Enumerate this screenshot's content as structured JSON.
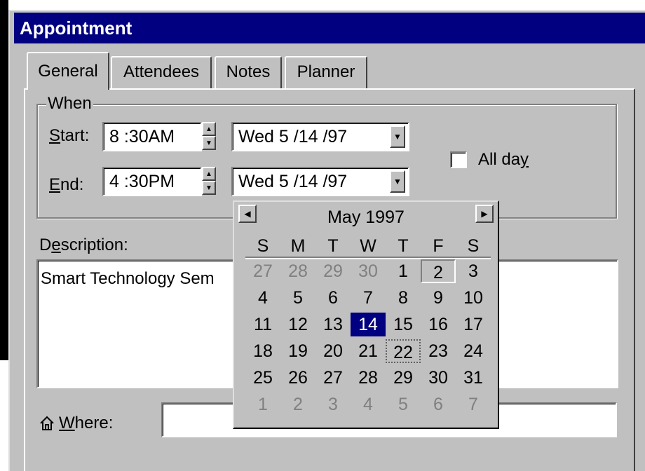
{
  "window": {
    "title": "Appointment"
  },
  "tabs": [
    {
      "label": "General",
      "active": true
    },
    {
      "label": "Attendees"
    },
    {
      "label": "Notes"
    },
    {
      "label": "Planner"
    }
  ],
  "when": {
    "group_label": "When",
    "start": {
      "label_u": "S",
      "label_rest": "tart:",
      "time": "8 :30AM",
      "date": "Wed  5  /14 /97"
    },
    "end": {
      "label_u": "E",
      "label_rest": "nd:",
      "time": "4 :30PM",
      "date": "Wed  5  /14 /97"
    },
    "all_day": {
      "label_pre": "All da",
      "label_u": "y",
      "checked": false
    }
  },
  "description": {
    "label_pre": "D",
    "label_u": "e",
    "label_rest": "scription:",
    "value": "Smart Technology Sem"
  },
  "where": {
    "label_u": "W",
    "label_rest": "here:",
    "value": "",
    "icon": "house-icon"
  },
  "calendar": {
    "month_label": "May 1997",
    "prev_icon": "left-arrow-icon",
    "next_icon": "right-arrow-icon",
    "weekdays": [
      "S",
      "M",
      "T",
      "W",
      "T",
      "F",
      "S"
    ],
    "weeks": [
      [
        "27",
        "28",
        "29",
        "30",
        "1",
        "2",
        "3"
      ],
      [
        "4",
        "5",
        "6",
        "7",
        "8",
        "9",
        "10"
      ],
      [
        "11",
        "12",
        "13",
        "14",
        "15",
        "16",
        "17"
      ],
      [
        "18",
        "19",
        "20",
        "21",
        "22",
        "23",
        "24"
      ],
      [
        "25",
        "26",
        "27",
        "28",
        "29",
        "30",
        "31"
      ],
      [
        "1",
        "2",
        "3",
        "4",
        "5",
        "6",
        "7"
      ]
    ],
    "selected_day": "14",
    "today_day": "22",
    "boxed_day": "2"
  },
  "colors": {
    "titlebar": "#000080",
    "face": "#c0c0c0",
    "selection": "#000080",
    "dimmed": "#808080"
  }
}
